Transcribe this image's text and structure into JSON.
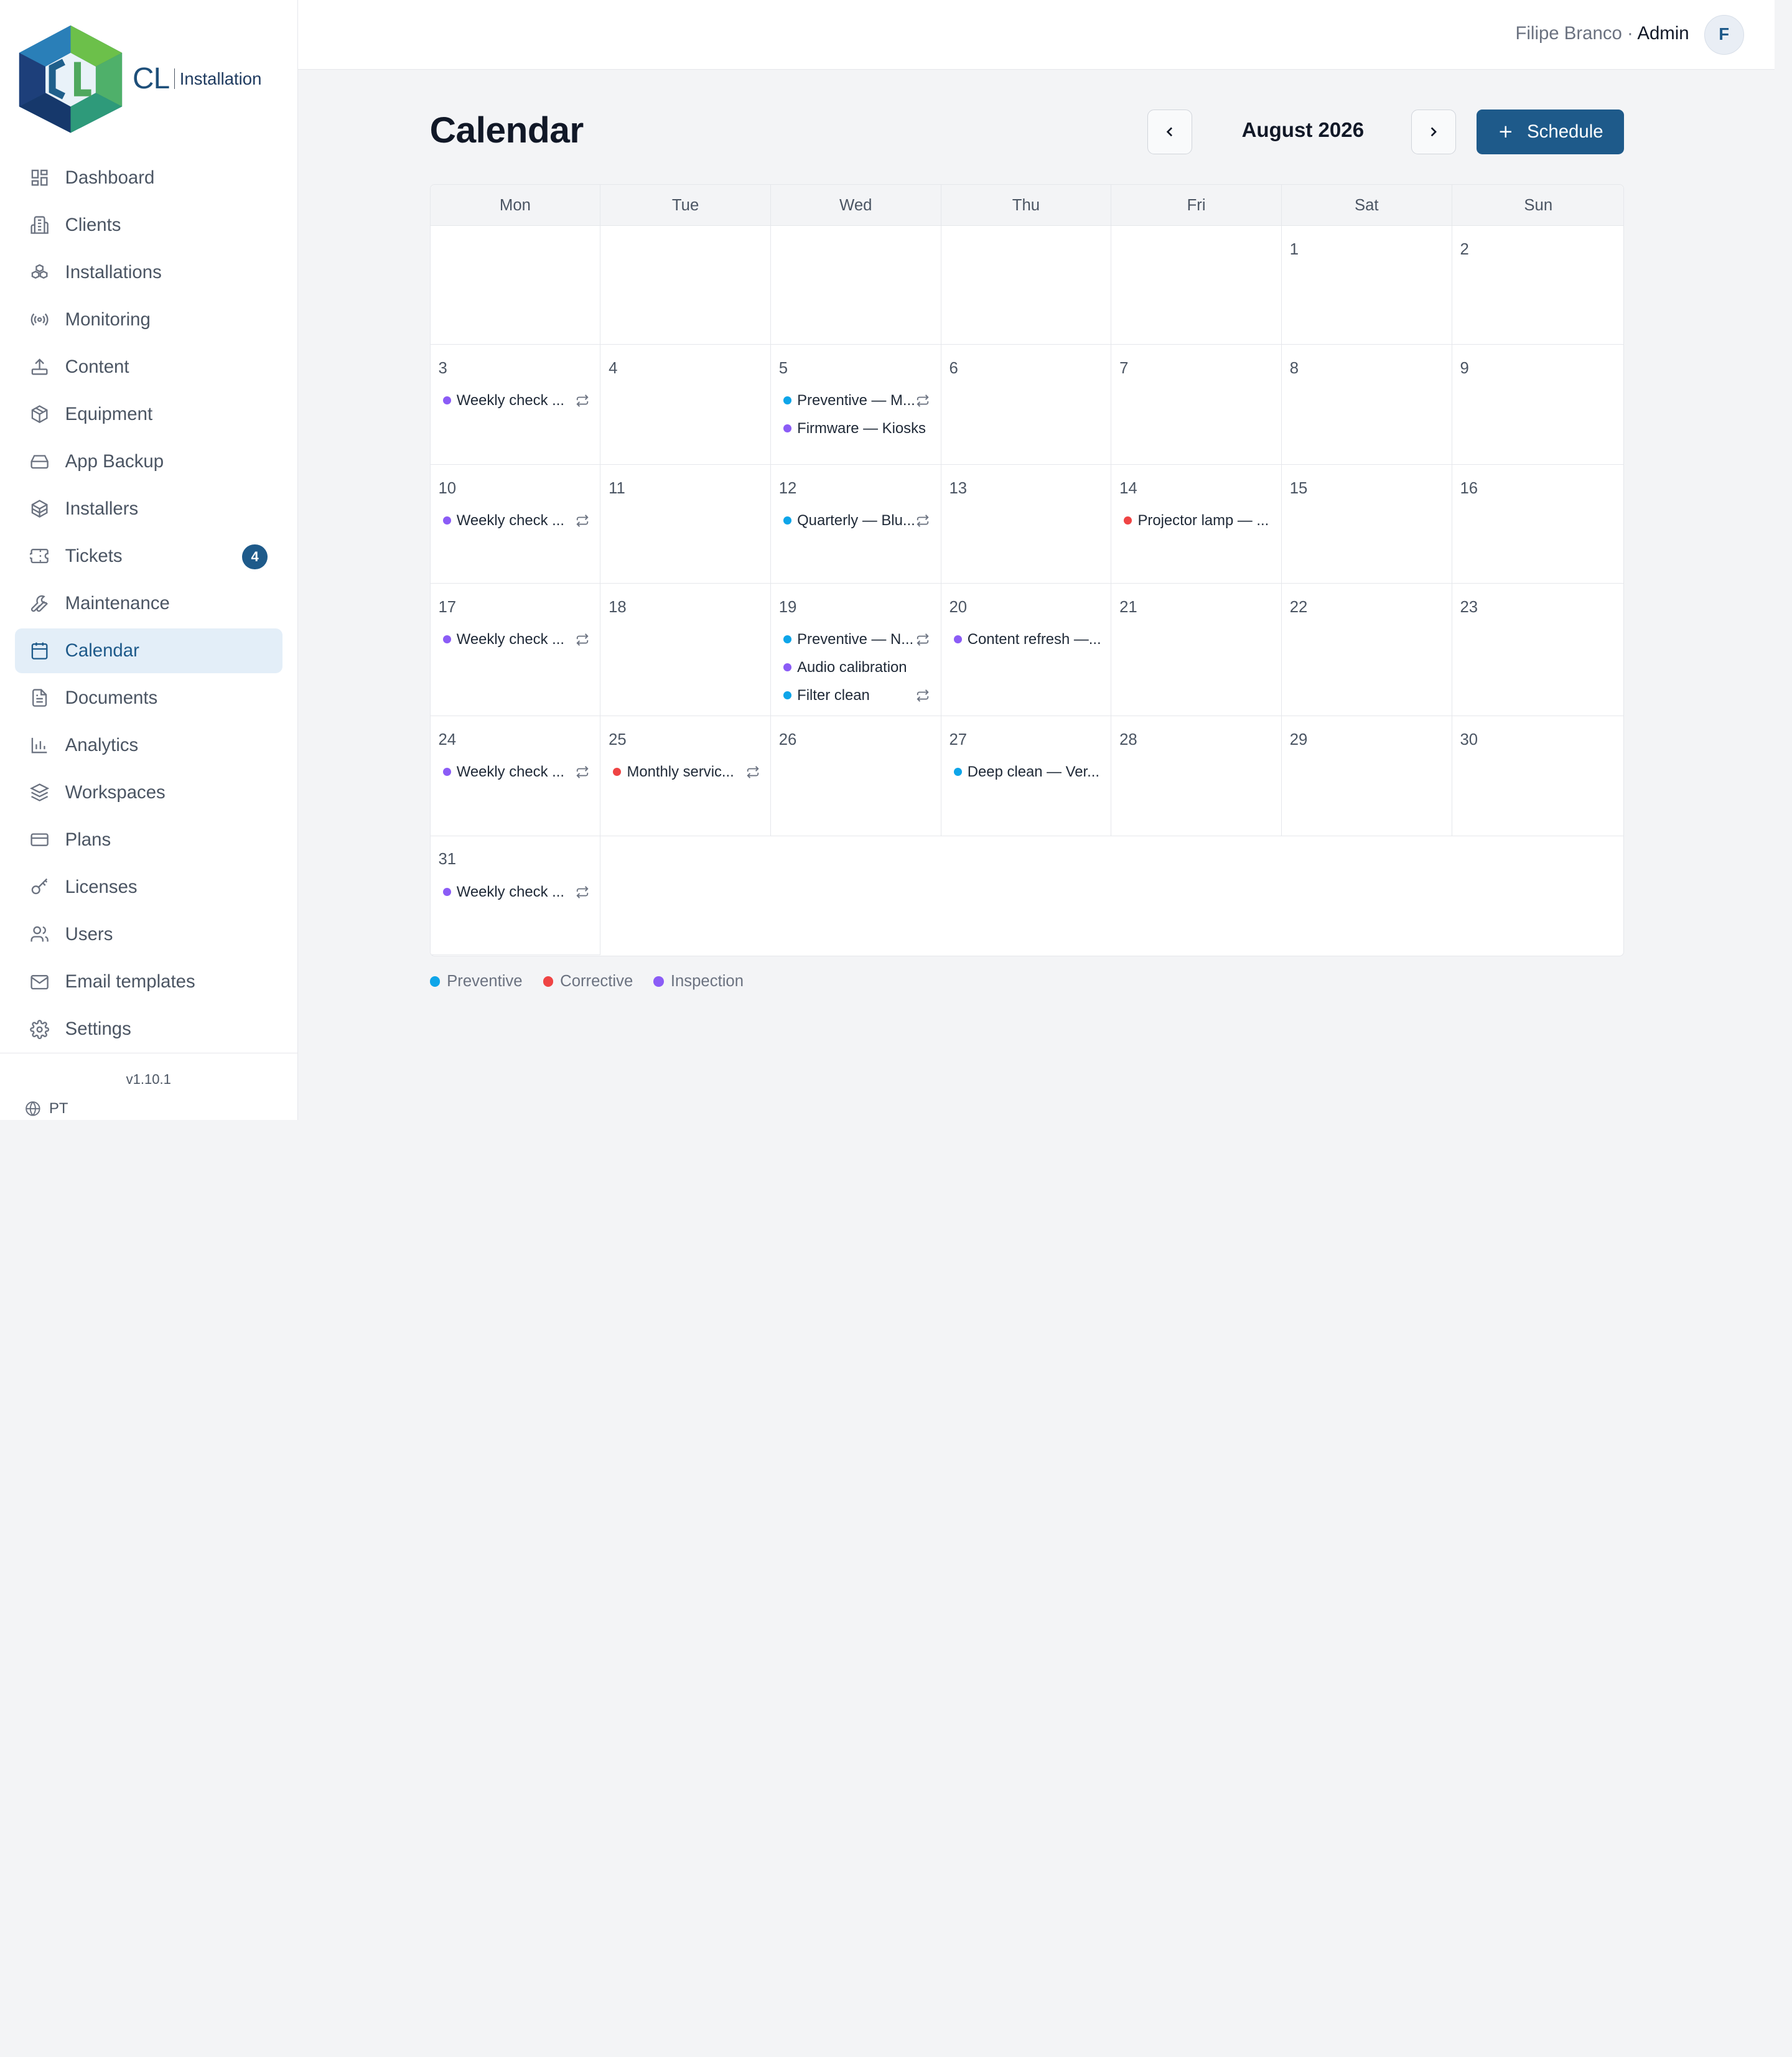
{
  "brand": {
    "name": "CL",
    "subtitle": "Installation"
  },
  "sidebar": {
    "items": [
      {
        "label": "Dashboard",
        "icon": "dashboard-icon"
      },
      {
        "label": "Clients",
        "icon": "building-icon"
      },
      {
        "label": "Installations",
        "icon": "boxes-icon"
      },
      {
        "label": "Monitoring",
        "icon": "radio-icon"
      },
      {
        "label": "Content",
        "icon": "upload-icon"
      },
      {
        "label": "Equipment",
        "icon": "package-icon"
      },
      {
        "label": "App Backup",
        "icon": "hard-drive-icon"
      },
      {
        "label": "Installers",
        "icon": "users-cube-icon"
      },
      {
        "label": "Tickets",
        "icon": "ticket-icon",
        "badge": "4"
      },
      {
        "label": "Maintenance",
        "icon": "wrench-icon"
      },
      {
        "label": "Calendar",
        "icon": "calendar-icon",
        "active": true
      },
      {
        "label": "Documents",
        "icon": "document-icon"
      },
      {
        "label": "Analytics",
        "icon": "bar-chart-icon"
      },
      {
        "label": "Workspaces",
        "icon": "layers-icon"
      },
      {
        "label": "Plans",
        "icon": "credit-card-icon"
      },
      {
        "label": "Licenses",
        "icon": "key-icon"
      },
      {
        "label": "Users",
        "icon": "users-icon"
      },
      {
        "label": "Email templates",
        "icon": "mail-icon"
      },
      {
        "label": "Settings",
        "icon": "gear-icon"
      }
    ],
    "version": "v1.10.1",
    "language": "PT"
  },
  "header": {
    "user_name": "Filipe Branco",
    "separator": " · ",
    "user_role": "Admin",
    "avatar_initial": "F"
  },
  "main": {
    "title": "Calendar",
    "month_label": "August 2026",
    "schedule_label": "Schedule",
    "weekdays": [
      "Mon",
      "Tue",
      "Wed",
      "Thu",
      "Fri",
      "Sat",
      "Sun"
    ],
    "weeks": [
      [
        {
          "day": ""
        },
        {
          "day": ""
        },
        {
          "day": ""
        },
        {
          "day": ""
        },
        {
          "day": ""
        },
        {
          "day": "1"
        },
        {
          "day": "2"
        }
      ],
      [
        {
          "day": "3",
          "events": [
            {
              "title": "Weekly check ...",
              "type": "inspection",
              "recurring": true
            }
          ]
        },
        {
          "day": "4"
        },
        {
          "day": "5",
          "events": [
            {
              "title": "Preventive — M...",
              "type": "preventive",
              "recurring": true
            },
            {
              "title": "Firmware — Kiosks",
              "type": "inspection",
              "recurring": false
            }
          ]
        },
        {
          "day": "6"
        },
        {
          "day": "7"
        },
        {
          "day": "8"
        },
        {
          "day": "9"
        }
      ],
      [
        {
          "day": "10",
          "events": [
            {
              "title": "Weekly check ...",
              "type": "inspection",
              "recurring": true
            }
          ]
        },
        {
          "day": "11"
        },
        {
          "day": "12",
          "events": [
            {
              "title": "Quarterly — Blu...",
              "type": "preventive",
              "recurring": true
            }
          ]
        },
        {
          "day": "13"
        },
        {
          "day": "14",
          "events": [
            {
              "title": "Projector lamp — ...",
              "type": "corrective",
              "recurring": false
            }
          ]
        },
        {
          "day": "15"
        },
        {
          "day": "16"
        }
      ],
      [
        {
          "day": "17",
          "events": [
            {
              "title": "Weekly check ...",
              "type": "inspection",
              "recurring": true
            }
          ]
        },
        {
          "day": "18"
        },
        {
          "day": "19",
          "events": [
            {
              "title": "Preventive — N...",
              "type": "preventive",
              "recurring": true
            },
            {
              "title": "Audio calibration",
              "type": "inspection",
              "recurring": false
            },
            {
              "title": "Filter clean",
              "type": "preventive",
              "recurring": true
            }
          ]
        },
        {
          "day": "20",
          "events": [
            {
              "title": "Content refresh —...",
              "type": "inspection",
              "recurring": false
            }
          ]
        },
        {
          "day": "21"
        },
        {
          "day": "22"
        },
        {
          "day": "23"
        }
      ],
      [
        {
          "day": "24",
          "events": [
            {
              "title": "Weekly check ...",
              "type": "inspection",
              "recurring": true
            }
          ]
        },
        {
          "day": "25",
          "events": [
            {
              "title": "Monthly servic...",
              "type": "corrective",
              "recurring": true
            }
          ]
        },
        {
          "day": "26"
        },
        {
          "day": "27",
          "events": [
            {
              "title": "Deep clean — Ver...",
              "type": "preventive",
              "recurring": false
            }
          ]
        },
        {
          "day": "28"
        },
        {
          "day": "29"
        },
        {
          "day": "30"
        }
      ],
      [
        {
          "day": "31",
          "events": [
            {
              "title": "Weekly check ...",
              "type": "inspection",
              "recurring": true
            }
          ]
        }
      ]
    ]
  },
  "legend": [
    {
      "label": "Preventive",
      "type": "preventive"
    },
    {
      "label": "Corrective",
      "type": "corrective"
    },
    {
      "label": "Inspection",
      "type": "inspection"
    }
  ],
  "colors": {
    "preventive": "#0ea5e9",
    "corrective": "#ef4444",
    "inspection": "#8b5cf6",
    "accent": "#1e5a8a"
  }
}
